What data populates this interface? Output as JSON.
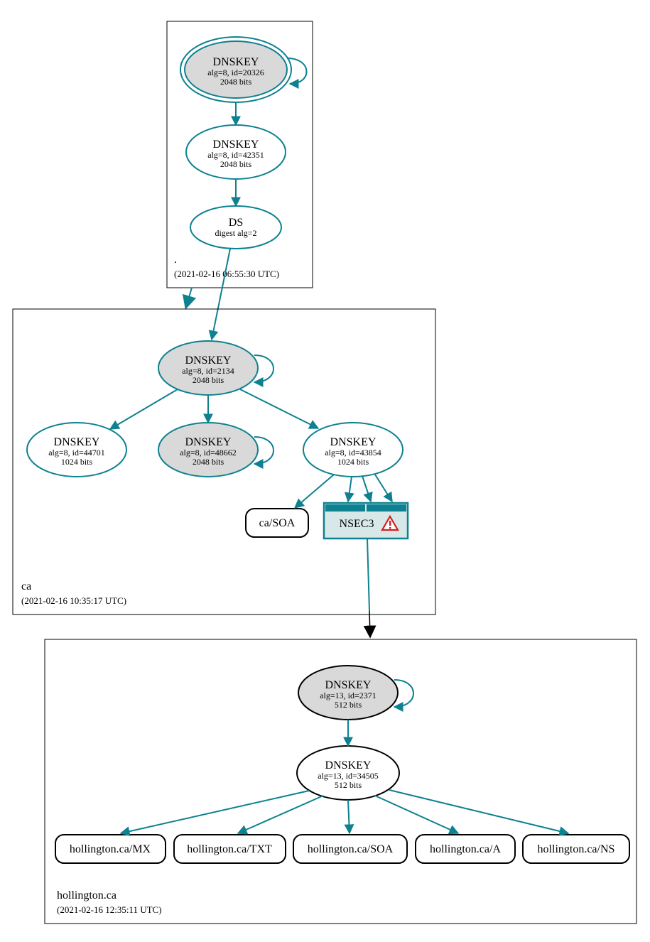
{
  "colors": {
    "teal": "#0d8190",
    "grey_fill": "#d9d9d9",
    "black": "#000000",
    "nsec3_bg": "#d8e7e8",
    "warning_red": "#d42020"
  },
  "zones": {
    "root": {
      "label": ".",
      "timestamp": "(2021-02-16 06:55:30 UTC)",
      "nodes": {
        "ksk": {
          "title": "DNSKEY",
          "line2": "alg=8, id=20326",
          "line3": "2048 bits"
        },
        "zsk": {
          "title": "DNSKEY",
          "line2": "alg=8, id=42351",
          "line3": "2048 bits"
        },
        "ds": {
          "title": "DS",
          "line2": "digest alg=2"
        }
      }
    },
    "ca": {
      "label": "ca",
      "timestamp": "(2021-02-16 10:35:17 UTC)",
      "nodes": {
        "ksk": {
          "title": "DNSKEY",
          "line2": "alg=8, id=2134",
          "line3": "2048 bits"
        },
        "zsk1": {
          "title": "DNSKEY",
          "line2": "alg=8, id=44701",
          "line3": "1024 bits"
        },
        "zsk2": {
          "title": "DNSKEY",
          "line2": "alg=8, id=48662",
          "line3": "2048 bits"
        },
        "zsk3": {
          "title": "DNSKEY",
          "line2": "alg=8, id=43854",
          "line3": "1024 bits"
        }
      },
      "rrsets": {
        "soa": {
          "label": "ca/SOA"
        },
        "nsec3": {
          "label": "NSEC3"
        }
      }
    },
    "hollington": {
      "label": "hollington.ca",
      "timestamp": "(2021-02-16 12:35:11 UTC)",
      "nodes": {
        "ksk": {
          "title": "DNSKEY",
          "line2": "alg=13, id=2371",
          "line3": "512 bits"
        },
        "zsk": {
          "title": "DNSKEY",
          "line2": "alg=13, id=34505",
          "line3": "512 bits"
        }
      },
      "rrsets": {
        "mx": {
          "label": "hollington.ca/MX"
        },
        "txt": {
          "label": "hollington.ca/TXT"
        },
        "soa": {
          "label": "hollington.ca/SOA"
        },
        "a": {
          "label": "hollington.ca/A"
        },
        "ns": {
          "label": "hollington.ca/NS"
        }
      }
    }
  }
}
